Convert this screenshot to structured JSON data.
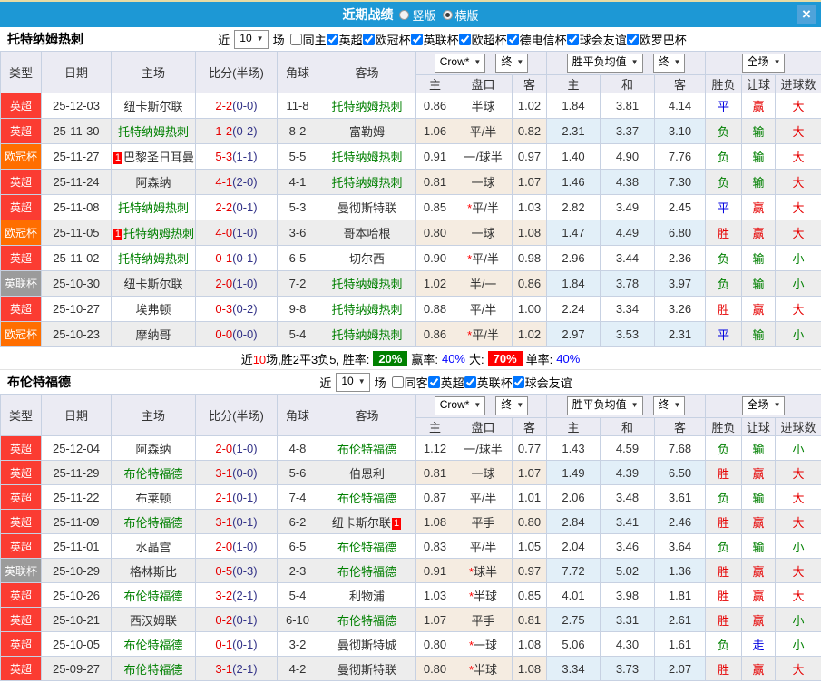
{
  "titlebar": {
    "title": "近期战绩",
    "radio_vertical": "竖版",
    "radio_horizontal": "横版",
    "radio_vertical_checked": false,
    "radio_horizontal_checked": true,
    "close_icon": "×"
  },
  "colors": {
    "titlebar_blue": "#1d98d5",
    "subject_team_green": "#008000",
    "score_red": "#e60000",
    "half_score_navy": "#333388",
    "win_badge_green": "#008000",
    "big_badge_red": "#ff0000",
    "pct_blue": "#0000ff",
    "league_colors": {
      "英超": "#fb3c32",
      "欧冠杯": "#ff6e00",
      "英联杯": "#9b9b9b"
    }
  },
  "header_labels": {
    "cols": [
      "类型",
      "日期",
      "主场",
      "比分(半场)",
      "角球",
      "客场"
    ],
    "sub": [
      "主",
      "盘口",
      "客",
      "主",
      "和",
      "客",
      "胜负",
      "让球",
      "进球数"
    ],
    "odds_company": "Crow*",
    "odds_final": "终",
    "avg_label": "胜平负均值",
    "avg_final": "终",
    "period": "全场"
  },
  "sections": [
    {
      "team": "托特纳姆热刺",
      "filter": {
        "near": "近",
        "count": "10",
        "games": "场",
        "checkboxes": [
          {
            "label": "同主",
            "checked": false
          },
          {
            "label": "英超",
            "checked": true
          },
          {
            "label": "欧冠杯",
            "checked": true
          },
          {
            "label": "英联杯",
            "checked": true
          },
          {
            "label": "欧超杯",
            "checked": true
          },
          {
            "label": "德电信杯",
            "checked": true
          },
          {
            "label": "球会友谊",
            "checked": true
          },
          {
            "label": "欧罗巴杯",
            "checked": true
          }
        ]
      },
      "rows": [
        {
          "league": "英超",
          "date": "25-12-03",
          "home": "纽卡斯尔联",
          "score": "2-2",
          "half": "0-0",
          "corners": "11-8",
          "away": "托特纳姆热刺",
          "away_green": true,
          "odds": [
            "0.86",
            "半球",
            "1.02"
          ],
          "avg": [
            "1.84",
            "3.81",
            "4.14"
          ],
          "results": [
            "平",
            "赢",
            "大"
          ]
        },
        {
          "league": "英超",
          "date": "25-11-30",
          "home": "托特纳姆热刺",
          "home_green": true,
          "score": "1-2",
          "half": "0-2",
          "corners": "8-2",
          "away": "富勒姆",
          "odds": [
            "1.06",
            "平/半",
            "0.82"
          ],
          "avg": [
            "2.31",
            "3.37",
            "3.10"
          ],
          "results": [
            "负",
            "输",
            "大"
          ]
        },
        {
          "league": "欧冠杯",
          "date": "25-11-27",
          "home": "巴黎圣日耳曼",
          "home_tag": "1",
          "score": "5-3",
          "half": "1-1",
          "corners": "5-5",
          "away": "托特纳姆热刺",
          "away_green": true,
          "odds": [
            "0.91",
            "一/球半",
            "0.97"
          ],
          "avg": [
            "1.40",
            "4.90",
            "7.76"
          ],
          "results": [
            "负",
            "输",
            "大"
          ]
        },
        {
          "league": "英超",
          "date": "25-11-24",
          "home": "阿森纳",
          "score": "4-1",
          "half": "2-0",
          "corners": "4-1",
          "away": "托特纳姆热刺",
          "away_green": true,
          "odds": [
            "0.81",
            "一球",
            "1.07"
          ],
          "avg": [
            "1.46",
            "4.38",
            "7.30"
          ],
          "results": [
            "负",
            "输",
            "大"
          ]
        },
        {
          "league": "英超",
          "date": "25-11-08",
          "home": "托特纳姆热刺",
          "home_green": true,
          "score": "2-2",
          "half": "0-1",
          "corners": "5-3",
          "away": "曼彻斯特联",
          "odds": [
            "0.85",
            "*平/半",
            "1.03"
          ],
          "avg": [
            "2.82",
            "3.49",
            "2.45"
          ],
          "results": [
            "平",
            "赢",
            "大"
          ]
        },
        {
          "league": "欧冠杯",
          "date": "25-11-05",
          "home": "托特纳姆热刺",
          "home_green": true,
          "home_tag": "1",
          "score": "4-0",
          "half": "1-0",
          "corners": "3-6",
          "away": "哥本哈根",
          "odds": [
            "0.80",
            "一球",
            "1.08"
          ],
          "avg": [
            "1.47",
            "4.49",
            "6.80"
          ],
          "results": [
            "胜",
            "赢",
            "大"
          ]
        },
        {
          "league": "英超",
          "date": "25-11-02",
          "home": "托特纳姆热刺",
          "home_green": true,
          "score": "0-1",
          "half": "0-1",
          "corners": "6-5",
          "away": "切尔西",
          "odds": [
            "0.90",
            "*平/半",
            "0.98"
          ],
          "avg": [
            "2.96",
            "3.44",
            "2.36"
          ],
          "results": [
            "负",
            "输",
            "小"
          ]
        },
        {
          "league": "英联杯",
          "date": "25-10-30",
          "home": "纽卡斯尔联",
          "score": "2-0",
          "half": "1-0",
          "corners": "7-2",
          "away": "托特纳姆热刺",
          "away_green": true,
          "odds": [
            "1.02",
            "半/一",
            "0.86"
          ],
          "avg": [
            "1.84",
            "3.78",
            "3.97"
          ],
          "results": [
            "负",
            "输",
            "小"
          ]
        },
        {
          "league": "英超",
          "date": "25-10-27",
          "home": "埃弗顿",
          "score": "0-3",
          "half": "0-2",
          "corners": "9-8",
          "away": "托特纳姆热刺",
          "away_green": true,
          "odds": [
            "0.88",
            "平/半",
            "1.00"
          ],
          "avg": [
            "2.24",
            "3.34",
            "3.26"
          ],
          "results": [
            "胜",
            "赢",
            "大"
          ]
        },
        {
          "league": "欧冠杯",
          "date": "25-10-23",
          "home": "摩纳哥",
          "score": "0-0",
          "half": "0-0",
          "corners": "5-4",
          "away": "托特纳姆热刺",
          "away_green": true,
          "odds": [
            "0.86",
            "*平/半",
            "1.02"
          ],
          "avg": [
            "2.97",
            "3.53",
            "2.31"
          ],
          "results": [
            "平",
            "输",
            "小"
          ]
        }
      ],
      "summary": {
        "t1": "近",
        "n": "10",
        "t2": "场,胜2平3负5, 胜率:",
        "win_pct": "20%",
        "t3": "赢率:",
        "win_rate": "40%",
        "t4": "大:",
        "big_pct": "70%",
        "t5": "单率:",
        "single_rate": "40%"
      }
    },
    {
      "team": "布伦特福德",
      "filter": {
        "near": "近",
        "count": "10",
        "games": "场",
        "checkboxes": [
          {
            "label": "同客",
            "checked": false
          },
          {
            "label": "英超",
            "checked": true
          },
          {
            "label": "英联杯",
            "checked": true
          },
          {
            "label": "球会友谊",
            "checked": true
          }
        ]
      },
      "rows": [
        {
          "league": "英超",
          "date": "25-12-04",
          "home": "阿森纳",
          "score": "2-0",
          "half": "1-0",
          "corners": "4-8",
          "away": "布伦特福德",
          "away_green": true,
          "odds": [
            "1.12",
            "一/球半",
            "0.77"
          ],
          "avg": [
            "1.43",
            "4.59",
            "7.68"
          ],
          "results": [
            "负",
            "输",
            "小"
          ]
        },
        {
          "league": "英超",
          "date": "25-11-29",
          "home": "布伦特福德",
          "home_green": true,
          "score": "3-1",
          "half": "0-0",
          "corners": "5-6",
          "away": "伯恩利",
          "odds": [
            "0.81",
            "一球",
            "1.07"
          ],
          "avg": [
            "1.49",
            "4.39",
            "6.50"
          ],
          "results": [
            "胜",
            "赢",
            "大"
          ]
        },
        {
          "league": "英超",
          "date": "25-11-22",
          "home": "布莱顿",
          "score": "2-1",
          "half": "0-1",
          "corners": "7-4",
          "away": "布伦特福德",
          "away_green": true,
          "odds": [
            "0.87",
            "平/半",
            "1.01"
          ],
          "avg": [
            "2.06",
            "3.48",
            "3.61"
          ],
          "results": [
            "负",
            "输",
            "大"
          ]
        },
        {
          "league": "英超",
          "date": "25-11-09",
          "home": "布伦特福德",
          "home_green": true,
          "score": "3-1",
          "half": "0-1",
          "corners": "6-2",
          "away": "纽卡斯尔联",
          "away_tag": "1",
          "odds": [
            "1.08",
            "平手",
            "0.80"
          ],
          "avg": [
            "2.84",
            "3.41",
            "2.46"
          ],
          "results": [
            "胜",
            "赢",
            "大"
          ]
        },
        {
          "league": "英超",
          "date": "25-11-01",
          "home": "水晶宫",
          "score": "2-0",
          "half": "1-0",
          "corners": "6-5",
          "away": "布伦特福德",
          "away_green": true,
          "odds": [
            "0.83",
            "平/半",
            "1.05"
          ],
          "avg": [
            "2.04",
            "3.46",
            "3.64"
          ],
          "results": [
            "负",
            "输",
            "小"
          ]
        },
        {
          "league": "英联杯",
          "date": "25-10-29",
          "home": "格林斯比",
          "score": "0-5",
          "half": "0-3",
          "corners": "2-3",
          "away": "布伦特福德",
          "away_green": true,
          "odds": [
            "0.91",
            "*球半",
            "0.97"
          ],
          "avg": [
            "7.72",
            "5.02",
            "1.36"
          ],
          "results": [
            "胜",
            "赢",
            "大"
          ]
        },
        {
          "league": "英超",
          "date": "25-10-26",
          "home": "布伦特福德",
          "home_green": true,
          "score": "3-2",
          "half": "2-1",
          "corners": "5-4",
          "away": "利物浦",
          "odds": [
            "1.03",
            "*半球",
            "0.85"
          ],
          "avg": [
            "4.01",
            "3.98",
            "1.81"
          ],
          "results": [
            "胜",
            "赢",
            "大"
          ]
        },
        {
          "league": "英超",
          "date": "25-10-21",
          "home": "西汉姆联",
          "score": "0-2",
          "half": "0-1",
          "corners": "6-10",
          "away": "布伦特福德",
          "away_green": true,
          "odds": [
            "1.07",
            "平手",
            "0.81"
          ],
          "avg": [
            "2.75",
            "3.31",
            "2.61"
          ],
          "results": [
            "胜",
            "赢",
            "小"
          ]
        },
        {
          "league": "英超",
          "date": "25-10-05",
          "home": "布伦特福德",
          "home_green": true,
          "score": "0-1",
          "half": "0-1",
          "corners": "3-2",
          "away": "曼彻斯特城",
          "odds": [
            "0.80",
            "*一球",
            "1.08"
          ],
          "avg": [
            "5.06",
            "4.30",
            "1.61"
          ],
          "results": [
            "负",
            "走",
            "小"
          ]
        },
        {
          "league": "英超",
          "date": "25-09-27",
          "home": "布伦特福德",
          "home_green": true,
          "score": "3-1",
          "half": "2-1",
          "corners": "4-2",
          "away": "曼彻斯特联",
          "odds": [
            "0.80",
            "*半球",
            "1.08"
          ],
          "avg": [
            "3.34",
            "3.73",
            "2.07"
          ],
          "results": [
            "胜",
            "赢",
            "大"
          ]
        }
      ]
    }
  ]
}
